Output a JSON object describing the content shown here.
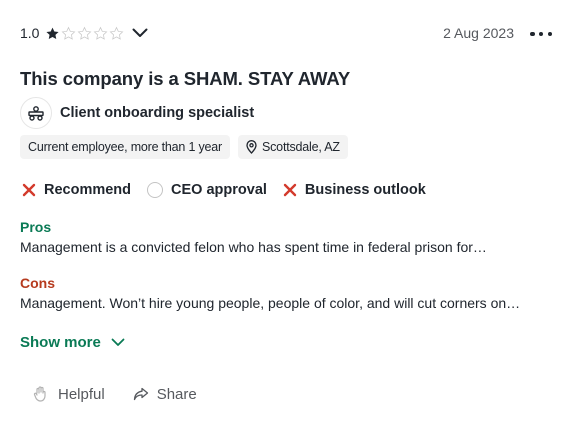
{
  "review": {
    "rating": "1.0",
    "stars_filled": 1,
    "stars_total": 5,
    "date": "2 Aug 2023",
    "title": "This company is a SHAM. STAY AWAY",
    "job_title": "Client onboarding specialist",
    "employment_status": "Current employee, more than 1 year",
    "location": "Scottsdale, AZ",
    "flags": {
      "recommend": {
        "label": "Recommend",
        "state": "negative",
        "icon": "x-icon"
      },
      "ceo_approval": {
        "label": "CEO approval",
        "state": "neutral",
        "icon": "empty-circle-icon"
      },
      "business_outlook": {
        "label": "Business outlook",
        "state": "negative",
        "icon": "x-icon"
      }
    },
    "pros": {
      "label": "Pros",
      "text": "Management is a convicted felon who has spent time in federal prison for…"
    },
    "cons": {
      "label": "Cons",
      "text": "Management. Won’t hire young people, people of color, and will cut corners on…"
    },
    "show_more_label": "Show more",
    "actions": {
      "helpful_label": "Helpful",
      "share_label": "Share"
    }
  },
  "colors": {
    "text": "#20262e",
    "muted": "#56595e",
    "pros": "#0a7a55",
    "cons": "#b63b1f",
    "negative_x": "#d33a2c",
    "tag_bg": "#f3f3f3"
  }
}
